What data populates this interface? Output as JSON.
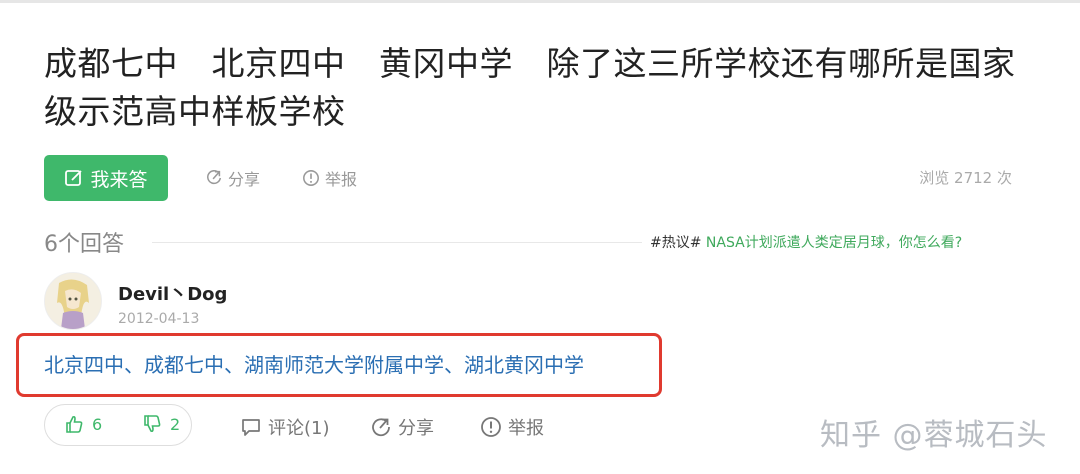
{
  "question": {
    "title": "成都七中　北京四中　黄冈中学　除了这三所学校还有哪所是国家级示范高中样板学校"
  },
  "actions": {
    "answer_label": "我来答",
    "share_label": "分享",
    "report_label": "举报",
    "views": "浏览 2712 次"
  },
  "answers_header": {
    "count_label": "6个回答",
    "hot_tag": "#热议#",
    "hot_link": " NASA计划派遣人类定居月球，你怎么看?"
  },
  "answer": {
    "author": "Devil丶Dog",
    "date": "2012-04-13",
    "content": "北京四中、成都七中、湖南师范大学附属中学、湖北黄冈中学",
    "upvotes": "6",
    "downvotes": "2",
    "comment_label": "评论(1)",
    "share_label": "分享",
    "report_label": "举报"
  },
  "watermark": "知乎 @蓉城石头",
  "colors": {
    "accent_green": "#3fb86b",
    "answer_link_blue": "#2b6fb3",
    "highlight_red": "#e03a2f"
  }
}
